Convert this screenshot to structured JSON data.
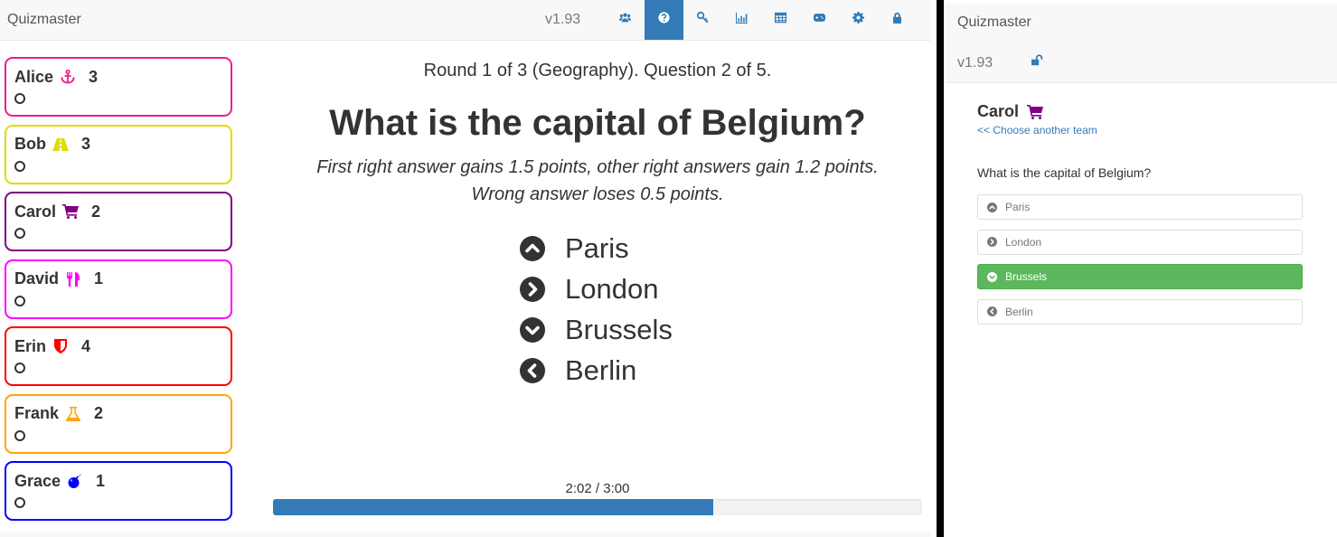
{
  "left": {
    "brand": "Quizmaster",
    "version": "v1.93",
    "nav_icons": [
      {
        "name": "teams-icon",
        "label": "Teams",
        "active": false
      },
      {
        "name": "question-icon",
        "label": "Question",
        "active": true
      },
      {
        "name": "key-icon",
        "label": "Answer key",
        "active": false
      },
      {
        "name": "chart-icon",
        "label": "Statistics",
        "active": false
      },
      {
        "name": "table-icon",
        "label": "Scoreboard",
        "active": false
      },
      {
        "name": "gamepad-icon",
        "label": "Game",
        "active": false
      },
      {
        "name": "gear-icon",
        "label": "Settings",
        "active": false
      },
      {
        "name": "lock-icon",
        "label": "Lock",
        "active": false
      }
    ],
    "teams": [
      {
        "name": "Alice",
        "icon": "anchor-icon",
        "color": "#ee1d8c",
        "score": "3"
      },
      {
        "name": "Bob",
        "icon": "road-icon",
        "color": "#dddd00",
        "score": "3"
      },
      {
        "name": "Carol",
        "icon": "shopping-cart-icon",
        "color": "#800080",
        "score": "2"
      },
      {
        "name": "David",
        "icon": "cutlery-icon",
        "color": "#ff00ff",
        "score": "1"
      },
      {
        "name": "Erin",
        "icon": "shield-icon",
        "color": "#ff0000",
        "score": "4"
      },
      {
        "name": "Frank",
        "icon": "flask-icon",
        "color": "#ffa500",
        "score": "2"
      },
      {
        "name": "Grace",
        "icon": "bomb-icon",
        "color": "#0000ff",
        "score": "1"
      }
    ],
    "round_info": "Round 1 of 3 (Geography). Question 2 of 5.",
    "question": "What is the capital of Belgium?",
    "rules_line1": "First right answer gains 1.5 points, other right answers gain 1.2 points.",
    "rules_line2": "Wrong answer loses 0.5 points.",
    "answers": [
      {
        "label": "Paris",
        "icon": "chevron-up-circle-icon"
      },
      {
        "label": "London",
        "icon": "chevron-right-circle-icon"
      },
      {
        "label": "Brussels",
        "icon": "chevron-down-circle-icon"
      },
      {
        "label": "Berlin",
        "icon": "chevron-left-circle-icon"
      }
    ],
    "timer": {
      "label": "2:02 / 3:00",
      "elapsed_seconds": 122,
      "total_seconds": 180,
      "progress_fraction": 0.678
    },
    "accent_color": "#337ab7"
  },
  "right": {
    "brand": "Quizmaster",
    "version": "v1.93",
    "unlock_icon": "unlock-icon",
    "team_name": "Carol",
    "team_icon": "shopping-cart-icon",
    "team_color": "#800080",
    "choose_another": "<< Choose another team",
    "question": "What is the capital of Belgium?",
    "options": [
      {
        "label": "Paris",
        "icon": "chevron-up-circle-icon",
        "selected": false
      },
      {
        "label": "London",
        "icon": "chevron-right-circle-icon",
        "selected": false
      },
      {
        "label": "Brussels",
        "icon": "chevron-down-circle-icon",
        "selected": true
      },
      {
        "label": "Berlin",
        "icon": "chevron-left-circle-icon",
        "selected": false
      }
    ],
    "selected_color": "#5cb85c"
  }
}
